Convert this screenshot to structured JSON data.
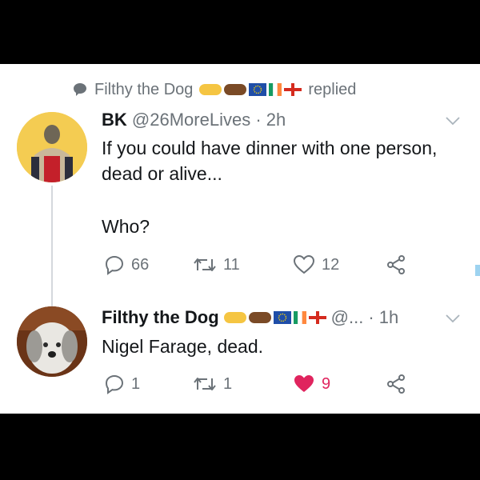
{
  "replied_line": {
    "name": "Filthy the Dog",
    "verb": "replied"
  },
  "tweet1": {
    "author": "BK",
    "handle": "@26MoreLives",
    "time": "· 2h",
    "line1": "If you could have dinner with one person,",
    "line2": "dead or alive...",
    "line3": "Who?",
    "replies": "66",
    "retweets": "11",
    "likes": "12"
  },
  "tweet2": {
    "author": "Filthy the Dog",
    "handle": "@...",
    "time": "· 1h",
    "text": "Nigel Farage, dead.",
    "replies": "1",
    "retweets": "1",
    "likes": "9"
  },
  "colors": {
    "like_active": "#e0245e",
    "muted": "#6b7278",
    "text": "#14171a"
  },
  "icons": [
    "speech-bubble-icon",
    "fist-emoji-icon",
    "eu-flag-icon",
    "ireland-flag-icon",
    "england-flag-icon",
    "chevron-down-icon",
    "reply-icon",
    "retweet-icon",
    "heart-icon",
    "share-icon"
  ]
}
